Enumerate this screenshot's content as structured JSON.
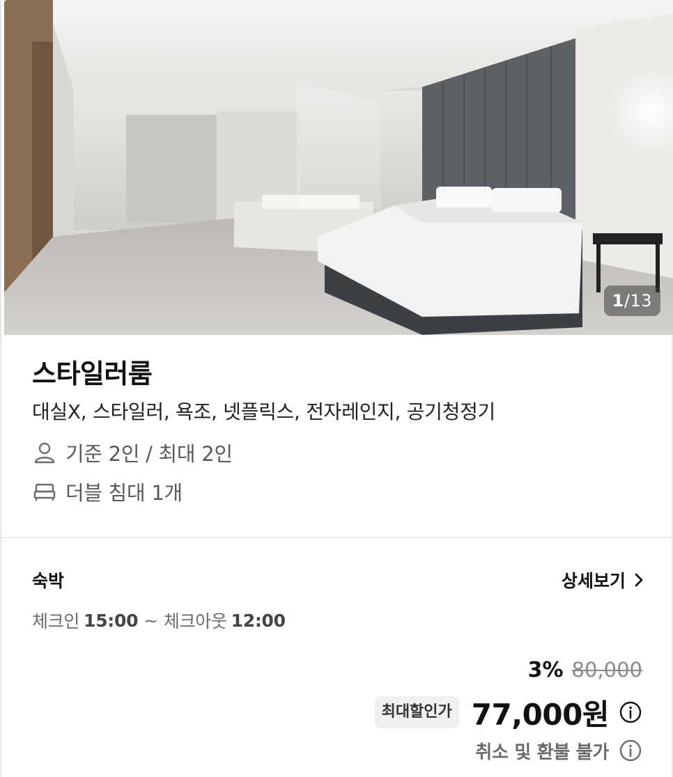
{
  "gallery": {
    "current": "1",
    "separator": "/",
    "total": "13"
  },
  "room": {
    "title": "스타일러룸",
    "amenities": "대실X, 스타일러, 욕조, 넷플릭스, 전자레인지, 공기청정기",
    "capacity": "기준 2인 / 최대 2인",
    "capacity_icon": "person-icon",
    "bed": "더블 침대 1개",
    "bed_icon": "bed-icon"
  },
  "stay": {
    "type": "숙박",
    "detail_label": "상세보기",
    "checkin_label": "체크인",
    "checkin_time": "15:00",
    "separator": "~",
    "checkout_label": "체크아웃",
    "checkout_time": "12:00"
  },
  "price": {
    "discount_rate": "3%",
    "original": "80,000",
    "badge": "최대할인가",
    "final": "77,000원",
    "refund_policy": "취소 및 환불 불가"
  },
  "colors": {
    "text_primary": "#111111",
    "text_secondary": "#595959",
    "divider": "#ececec",
    "badge_bg": "#f0f0f0"
  }
}
